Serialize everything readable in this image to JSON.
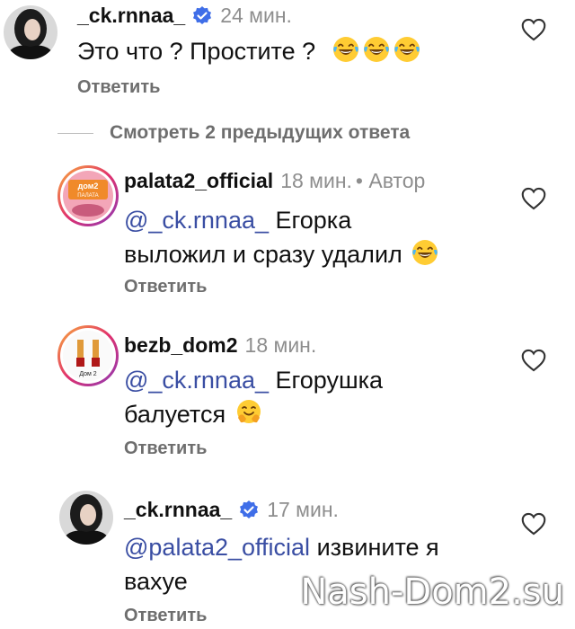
{
  "comments": [
    {
      "username": "_ck.rnnaa_",
      "time": "24 мин.",
      "text": "Это что ? Простите ?",
      "reply_label": "Ответить",
      "emojis": [
        "laughing-crying-emoji",
        "laughing-crying-emoji",
        "laughing-crying-emoji"
      ]
    },
    {
      "username": "palata2_official",
      "time": "18 мин.",
      "author_label": "• Автор",
      "mention": "@_ck.rnnaa_",
      "text_line1": " Егорка",
      "text_line2": "выложил и сразу удалил",
      "reply_label": "Ответить",
      "avatar_text_top": "дом2",
      "avatar_text_bottom": "ПАЛАТА"
    },
    {
      "username": "bezb_dom2",
      "time": "18 мин.",
      "mention": "@_ck.rnnaa_",
      "text_line1": " Егорушка",
      "text_line2": "балуется",
      "reply_label": "Ответить",
      "avatar_text": "Дом 2"
    },
    {
      "username": "_ck.rnnaa_",
      "time": "17 мин.",
      "mention": "@palata2_official",
      "text_line1": " извините я",
      "text_line2": "вахуе",
      "reply_label": "Ответить"
    }
  ],
  "view_replies": "Смотреть 2 предыдущих ответа",
  "watermark": "Nash-Dom2.su",
  "colors": {
    "mention": "#3a4ea3",
    "verified": "#3f6ee8",
    "secondary": "#8e8e8e"
  }
}
